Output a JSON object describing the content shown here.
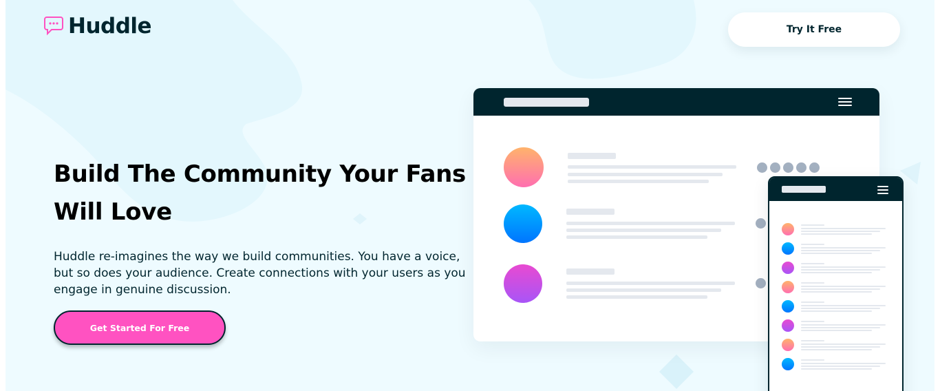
{
  "brand": {
    "name": "Huddle",
    "accent": "#ff52c1",
    "dark": "#00252e",
    "background": "#eefbff"
  },
  "header": {
    "logo_icon": "chat-bubble-icon",
    "try_label": "Try It Free"
  },
  "hero": {
    "title": "Build The Community Your Fans Will Love",
    "description": "Huddle re-imagines the way we build communities. You have a voice, but so does your audience. Create connections with your users as you engage in genuine discussion.",
    "cta_label": "Get Started For Free"
  },
  "mockup": {
    "menu_icon": "hamburger-menu-icon",
    "avatars": [
      "orange-gradient",
      "blue-gradient",
      "purple-gradient"
    ],
    "phone_avatars": [
      "orange-gradient",
      "blue-gradient",
      "purple-gradient",
      "orange-gradient",
      "blue-gradient",
      "purple-gradient",
      "orange-gradient",
      "blue-gradient"
    ]
  }
}
